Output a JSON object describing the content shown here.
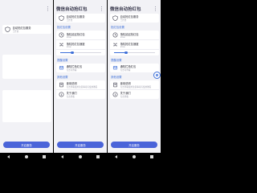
{
  "app_title": "微信自动抢红包",
  "menu_glyph": "⋮",
  "accent": "#3d6fd8",
  "button_color": "#4a64d9",
  "sections": {
    "settings": "抢红包设置",
    "notify": "提醒设置",
    "others": "其他设置"
  },
  "items": {
    "service": {
      "title": "自动抢红包服务",
      "sub": "已开启"
    },
    "delay": {
      "title": "随机延迟抢红包",
      "sub": "Slow"
    },
    "speed": {
      "title": "随机抢红包速度",
      "sub": "Slow"
    },
    "notification": {
      "title": "通知栏抢红包",
      "sub": "点击可查看"
    },
    "guide": {
      "title": "使用说明",
      "sub": "点击查看使用注意事项与使用教程"
    },
    "feedback": {
      "title": "关于我们",
      "sub": "点击查看"
    }
  },
  "slider_level": 0.3,
  "bottom_button": "开启服务",
  "icons": {
    "service": "shield-icon",
    "delay": "clock-icon",
    "speed": "shuffle-icon",
    "notification": "bell-icon",
    "guide": "book-icon",
    "feedback": "info-icon",
    "fab": "float-circle-icon"
  }
}
